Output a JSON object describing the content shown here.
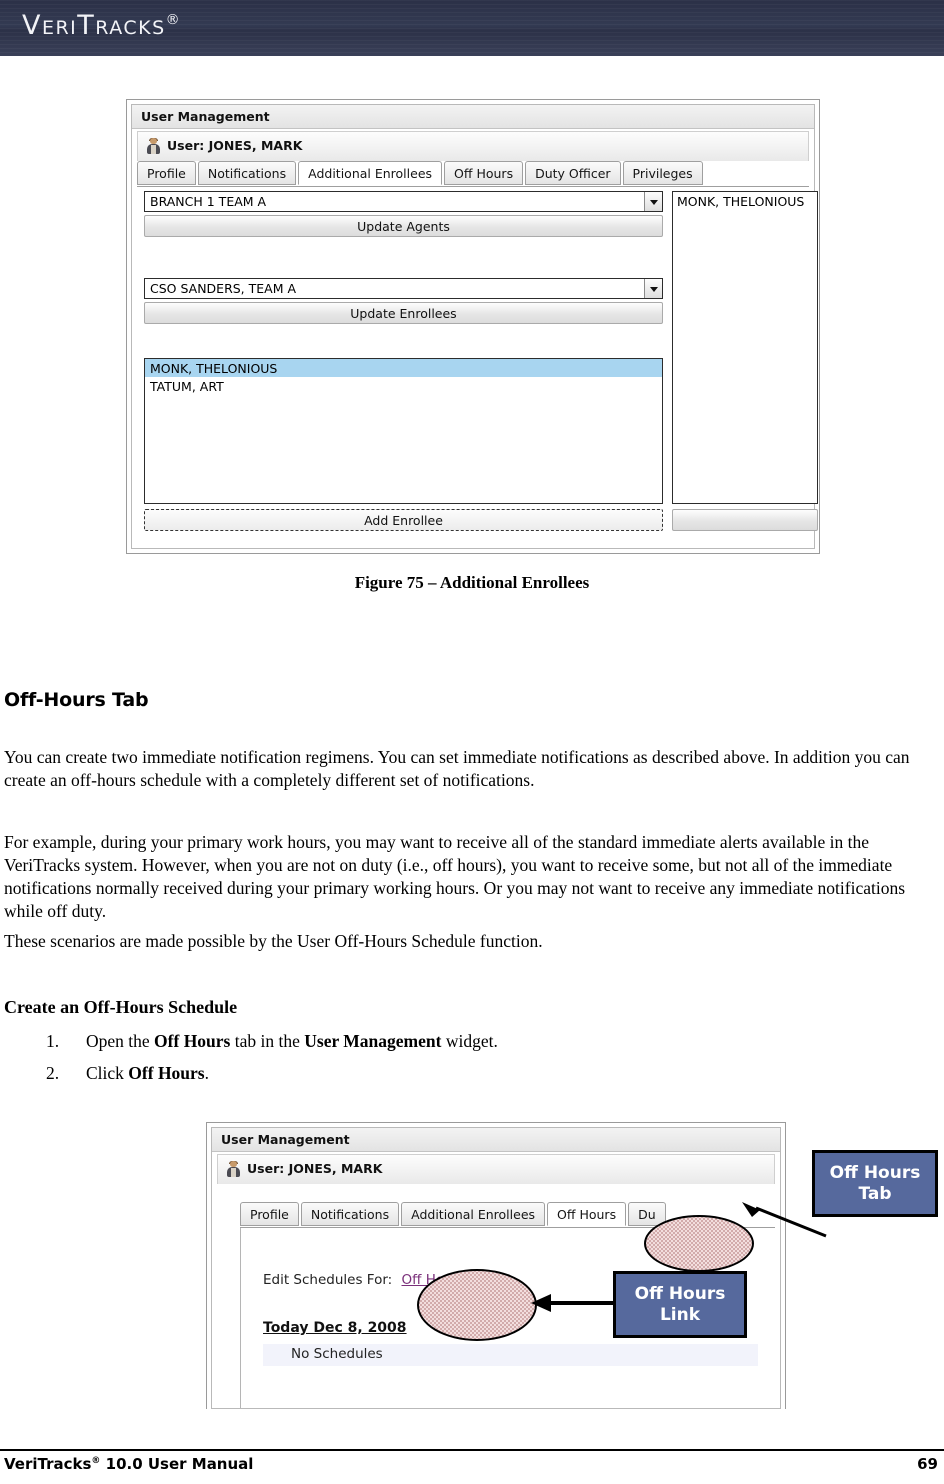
{
  "header": {
    "brand": "VeriTracks",
    "registered_mark": "®"
  },
  "figure1": {
    "widget_title": "User Management",
    "user_label": "User: JONES, MARK",
    "tabs": [
      {
        "label": "Profile",
        "active": false
      },
      {
        "label": "Notifications",
        "active": false
      },
      {
        "label": "Additional Enrollees",
        "active": true
      },
      {
        "label": "Off Hours",
        "active": false
      },
      {
        "label": "Duty Officer",
        "active": false
      },
      {
        "label": "Privileges",
        "active": false
      }
    ],
    "agents_select_value": "BRANCH 1 TEAM A",
    "update_agents_button": "Update Agents",
    "enrollees_select_value": "CSO SANDERS, TEAM A",
    "update_enrollees_button": "Update Enrollees",
    "enrollee_list": [
      "MONK, THELONIOUS",
      "TATUM, ART"
    ],
    "enrollee_list_selected": "MONK, THELONIOUS",
    "add_enrollee_button": "Add Enrollee",
    "right_panel_list": [
      "MONK, THELONIOUS"
    ],
    "caption": "Figure 75 – Additional Enrollees"
  },
  "body": {
    "heading": "Off-Hours Tab",
    "paragraph1": "You can create two immediate notification regimens. You can set immediate notifications as described above. In addition you can create an off-hours schedule with a completely different set of notifications.",
    "paragraph2": "For example, during your primary work hours, you may want to receive all of the standard immediate alerts available in the VeriTracks system. However, when you are not on duty (i.e., off hours), you want to receive some, but not all of the immediate notifications normally received during your primary working hours. Or you may not want to receive any immediate notifications while off duty.",
    "paragraph3": "These scenarios are made possible by the User Off-Hours Schedule function.",
    "subheading": "Create an Off-Hours Schedule",
    "steps": [
      {
        "num": "1.",
        "prefix": "Open the ",
        "bold1": "Off Hours",
        "mid": " tab in the ",
        "bold2": "User Management",
        "suffix": " widget."
      },
      {
        "num": "2.",
        "prefix": "Click ",
        "bold1": "Off Hours",
        "mid": "",
        "bold2": "",
        "suffix": "."
      }
    ]
  },
  "figure2": {
    "widget_title": "User Management",
    "user_label": "User: JONES, MARK",
    "tabs": [
      {
        "label": "Profile",
        "active": false
      },
      {
        "label": "Notifications",
        "active": false
      },
      {
        "label": "Additional Enrollees",
        "active": false
      },
      {
        "label": "Off Hours",
        "active": true
      },
      {
        "label": "Du",
        "active": false
      }
    ],
    "edit_schedules_label": "Edit Schedules For:",
    "edit_schedules_link": "Off Hours",
    "today_heading": "Today Dec 8, 2008",
    "no_schedules": "No Schedules",
    "annotations": [
      {
        "label": "Off Hours\nTab",
        "line1": "Off Hours",
        "line2": "Tab"
      },
      {
        "label": "Off Hours\nLink",
        "line1": "Off Hours",
        "line2": "Link"
      }
    ]
  },
  "footer": {
    "left_text": "VeriTracks",
    "left_mark": "®",
    "left_rest": " 10.0 User Manual",
    "page_number": "69"
  },
  "colors": {
    "banner": "#2e3349",
    "callout_fill": "#56699d",
    "ellipse_fill": "#f3dede",
    "link": "#7a2f7a",
    "list_selected": "#a8d5f0"
  }
}
